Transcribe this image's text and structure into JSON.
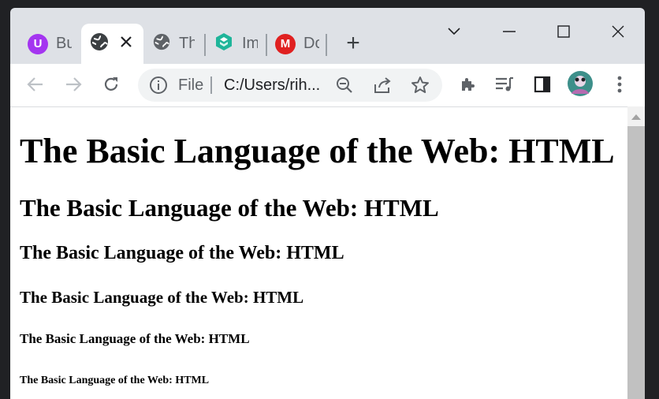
{
  "browser": {
    "tabs": [
      {
        "title": "Bu",
        "favicon": "udemy-icon",
        "color": "#a435f0",
        "letter": "U"
      },
      {
        "title": "",
        "favicon": "globe-icon",
        "active": true
      },
      {
        "title": "Th",
        "favicon": "globe-icon"
      },
      {
        "title": "Im",
        "favicon": "gem-icon",
        "color": "#1fb59a"
      },
      {
        "title": "Do",
        "favicon": "mega-icon",
        "color": "#e02020",
        "letter": "M"
      }
    ],
    "new_tab_label": "+",
    "omnibox": {
      "file_label": "File",
      "url": "C:/Users/rih..."
    }
  },
  "page": {
    "h1": "The Basic Language of the Web: HTML",
    "h2": "The Basic Language of the Web: HTML",
    "h3": "The Basic Language of the Web: HTML",
    "h4": "The Basic Language of the Web: HTML",
    "h5": "The Basic Language of the Web: HTML",
    "h6": "The Basic Language of the Web: HTML"
  },
  "colors": {
    "chrome_frame": "#dee1e6",
    "toolbar": "#ffffff",
    "icon_dark": "#5f6368"
  }
}
